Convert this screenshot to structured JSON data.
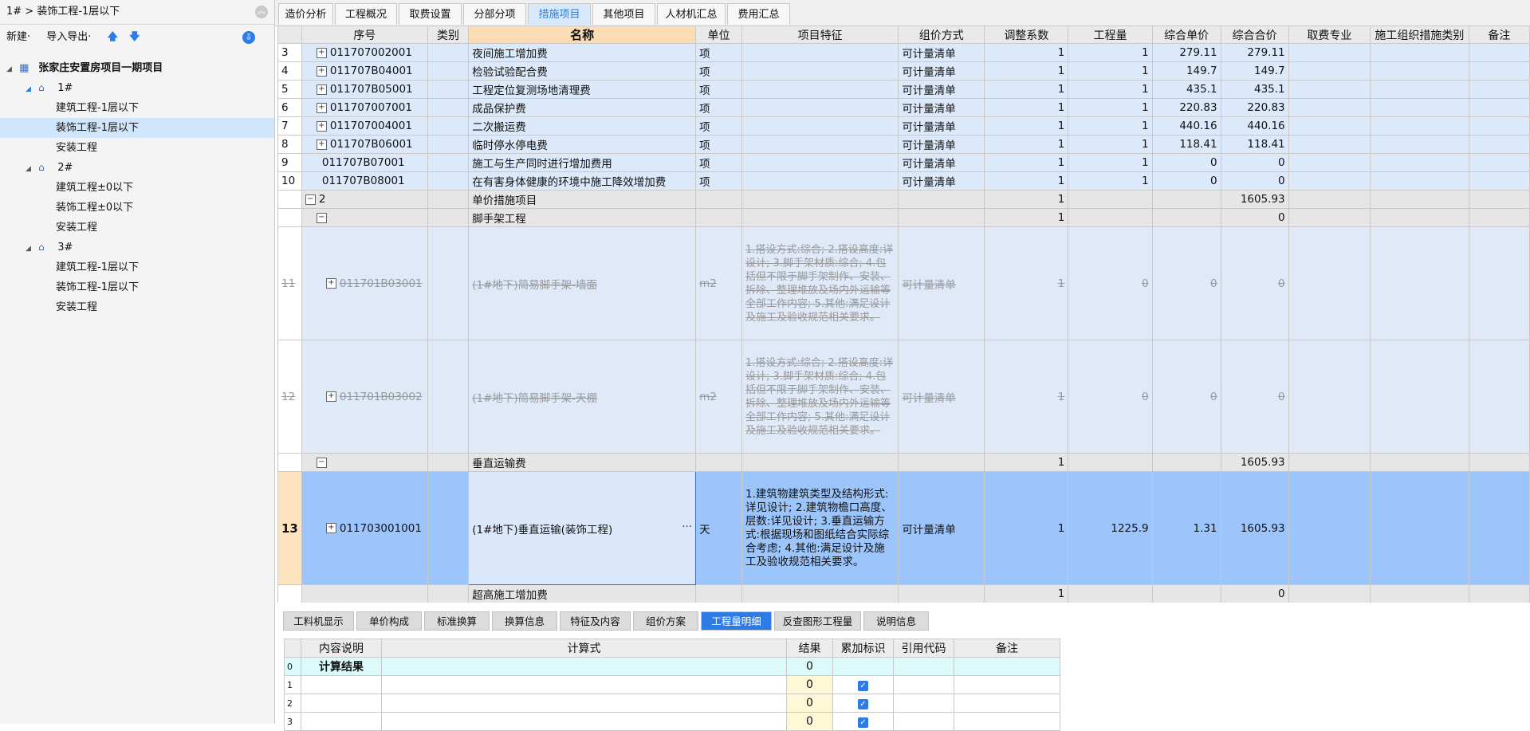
{
  "breadcrumb": "1# > 装饰工程-1层以下",
  "left_toolbar": {
    "new": "新建·",
    "import_export": "导入导出·",
    "up": "🡅",
    "down": "🡇"
  },
  "tree": {
    "root": "张家庄安置房项目一期项目",
    "b1": "1#",
    "b1_items": [
      "建筑工程-1层以下",
      "装饰工程-1层以下",
      "安装工程"
    ],
    "b2": "2#",
    "b2_items": [
      "建筑工程±0以下",
      "装饰工程±0以下",
      "安装工程"
    ],
    "b3": "3#",
    "b3_items": [
      "建筑工程-1层以下",
      "装饰工程-1层以下",
      "安装工程"
    ]
  },
  "tabs": [
    "造价分析",
    "工程概况",
    "取费设置",
    "分部分项",
    "措施项目",
    "其他项目",
    "人材机汇总",
    "费用汇总"
  ],
  "columns": [
    "序号",
    "类别",
    "名称",
    "单位",
    "项目特征",
    "组价方式",
    "调整系数",
    "工程量",
    "综合单价",
    "综合合价",
    "取费专业",
    "施工组织措施类别",
    "备注"
  ],
  "rows": [
    {
      "idx": "3",
      "code": "011707002001",
      "name": "夜间施工增加费",
      "unit": "项",
      "method": "可计量清单",
      "coef": "1",
      "qty": "1",
      "price": "279.11",
      "total": "279.11"
    },
    {
      "idx": "4",
      "code": "011707B04001",
      "name": "检验试验配合费",
      "unit": "项",
      "method": "可计量清单",
      "coef": "1",
      "qty": "1",
      "price": "149.7",
      "total": "149.7"
    },
    {
      "idx": "5",
      "code": "011707B05001",
      "name": "工程定位复测场地清理费",
      "unit": "项",
      "method": "可计量清单",
      "coef": "1",
      "qty": "1",
      "price": "435.1",
      "total": "435.1"
    },
    {
      "idx": "6",
      "code": "011707007001",
      "name": "成品保护费",
      "unit": "项",
      "method": "可计量清单",
      "coef": "1",
      "qty": "1",
      "price": "220.83",
      "total": "220.83"
    },
    {
      "idx": "7",
      "code": "011707004001",
      "name": "二次搬运费",
      "unit": "项",
      "method": "可计量清单",
      "coef": "1",
      "qty": "1",
      "price": "440.16",
      "total": "440.16"
    },
    {
      "idx": "8",
      "code": "011707B06001",
      "name": "临时停水停电费",
      "unit": "项",
      "method": "可计量清单",
      "coef": "1",
      "qty": "1",
      "price": "118.41",
      "total": "118.41"
    },
    {
      "idx": "9",
      "code": "011707B07001",
      "name": "施工与生产同时进行增加费用",
      "unit": "项",
      "method": "可计量清单",
      "coef": "1",
      "qty": "1",
      "price": "0",
      "total": "0"
    },
    {
      "idx": "10",
      "code": "011707B08001",
      "name": "在有害身体健康的环境中施工降效增加费",
      "unit": "项",
      "method": "可计量清单",
      "coef": "1",
      "qty": "1",
      "price": "0",
      "total": "0"
    }
  ],
  "group2": {
    "code": "2",
    "name": "单价措施项目",
    "coef": "1",
    "total": "1605.93"
  },
  "scaffold": {
    "name": "脚手架工程",
    "coef": "1",
    "total": "0"
  },
  "row11": {
    "idx": "11",
    "code": "011701B03001",
    "name": "(1#地下)简易脚手架-墙面",
    "unit": "m2",
    "feature": "1.搭设方式:综合;\n2.搭设高度:详设计;\n3.脚手架材质:综合;\n4.包括但不限于脚手架制作、安装、拆除、整理堆放及场内外运输等全部工作内容;\n5.其他:满足设计及施工及验收规范相关要求。",
    "method": "可计量清单",
    "coef": "1",
    "qty": "0",
    "price": "0",
    "total": "0"
  },
  "row12": {
    "idx": "12",
    "code": "011701B03002",
    "name": "(1#地下)简易脚手架-天棚",
    "unit": "m2",
    "feature": "1.搭设方式:综合;\n2.搭设高度:详设计;\n3.脚手架材质:综合;\n4.包括但不限于脚手架制作、安装、拆除、整理堆放及场内外运输等全部工作内容;\n5.其他:满足设计及施工及验收规范相关要求。",
    "method": "可计量清单",
    "coef": "1",
    "qty": "0",
    "price": "0",
    "total": "0"
  },
  "vert": {
    "name": "垂直运输费",
    "coef": "1",
    "total": "1605.93"
  },
  "row13": {
    "idx": "13",
    "code": "011703001001",
    "name": "(1#地下)垂直运输(装饰工程)",
    "unit": "天",
    "feature": "1.建筑物建筑类型及结构形式:详见设计;\n2.建筑物檐口高度、层数:详见设计;\n3.垂直运输方式:根据现场和图纸结合实际综合考虑;\n4.其他:满足设计及施工及验收规范相关要求。",
    "method": "可计量清单",
    "coef": "1",
    "qty": "1225.9",
    "price": "1.31",
    "total": "1605.93"
  },
  "super": {
    "name": "超高施工增加费",
    "coef": "1",
    "total": "0"
  },
  "bottom_tabs": [
    "工料机显示",
    "单价构成",
    "标准换算",
    "换算信息",
    "特征及内容",
    "组价方案",
    "工程量明细",
    "反查图形工程量",
    "说明信息"
  ],
  "detail_columns": [
    "内容说明",
    "计算式",
    "结果",
    "累加标识",
    "引用代码",
    "备注"
  ],
  "detail_rows": [
    {
      "idx": "0",
      "desc": "计算结果",
      "result": "0"
    },
    {
      "idx": "1",
      "desc": "",
      "result": "0"
    },
    {
      "idx": "2",
      "desc": "",
      "result": "0"
    },
    {
      "idx": "3",
      "desc": "",
      "result": "0"
    }
  ]
}
